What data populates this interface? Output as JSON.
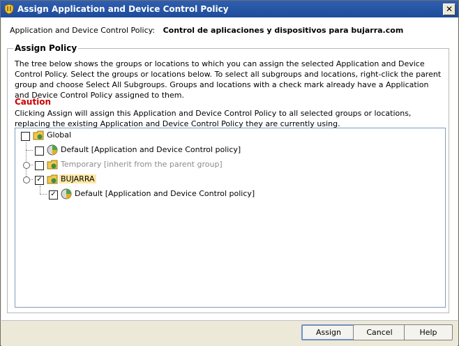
{
  "window": {
    "title": "Assign Application and Device Control Policy",
    "close_label": "✕"
  },
  "policy": {
    "label": "Application and Device Control Policy:",
    "value": "Control de aplicaciones y dispositivos para bujarra.com"
  },
  "assign_policy": {
    "title": "Assign Policy",
    "description": "The tree below shows the groups or locations to which you can assign the selected Application and Device Control Policy. Select the groups or locations below. To select all subgroups and locations, right-click the parent group and choose Select All Subgroups. Groups and locations with a check mark already have a Application and Device Control Policy assigned to them.",
    "caution_title": "Caution",
    "caution_text": "Clicking Assign will assign this Application and Device Control Policy to all selected groups or locations, replacing the existing Application and Device Control Policy they are currently using."
  },
  "tree": {
    "nodes": [
      {
        "label": "Global",
        "checked": false
      },
      {
        "label": "Default [Application and Device Control policy]",
        "checked": false
      },
      {
        "label": "Temporary [inherit from the parent group]",
        "checked": false
      },
      {
        "label": "BUJARRA",
        "checked": true
      },
      {
        "label": "Default [Application and Device Control policy]",
        "checked": true
      }
    ]
  },
  "buttons": {
    "assign": "Assign",
    "cancel": "Cancel",
    "help": "Help"
  },
  "colors": {
    "titlebar": "#2f5fb0",
    "caution": "#cc0000",
    "highlight": "#ffe8a6"
  }
}
